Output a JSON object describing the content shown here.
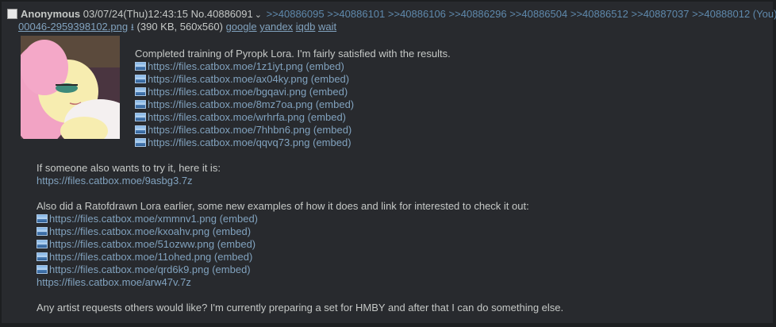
{
  "post": {
    "name": "Anonymous",
    "datetime": "03/07/24(Thu)12:43:15",
    "post_no": "No.40886091",
    "backlinks": [
      ">>40886095",
      ">>40886101",
      ">>40886106",
      ">>40886296",
      ">>40886504",
      ">>40886512",
      ">>40887037",
      ">>40888012 (You)"
    ],
    "file": {
      "name": "00046-2959398102.png",
      "meta": "(390 KB, 560x560)",
      "search_links": [
        "google",
        "yandex",
        "iqdb",
        "wait"
      ]
    },
    "intro": "Completed training of Pyropk Lora. I'm fairly satisfied with the results.",
    "links1": [
      "https://files.catbox.moe/1z1iyt.png (embed)",
      "https://files.catbox.moe/ax04ky.png (embed)",
      "https://files.catbox.moe/bgqavi.png (embed)",
      "https://files.catbox.moe/8mz7oa.png (embed)",
      "https://files.catbox.moe/wrhrfa.png (embed)",
      "https://files.catbox.moe/7hhbn6.png (embed)",
      "https://files.catbox.moe/qqvq73.png (embed)"
    ],
    "try_text": "If someone also wants to try it, here it is:",
    "try_link": "https://files.catbox.moe/9asbg3.7z",
    "also_text": "Also did a Ratofdrawn Lora earlier, some new examples of how it does and link for interested to check it out:",
    "links2": [
      "https://files.catbox.moe/xmmnv1.png (embed)",
      "https://files.catbox.moe/kxoahv.png (embed)",
      "https://files.catbox.moe/51ozww.png (embed)",
      "https://files.catbox.moe/11ohed.png (embed)",
      "https://files.catbox.moe/qrd6k9.png (embed)"
    ],
    "arw_link": "https://files.catbox.moe/arw47v.7z",
    "closing": "Any artist requests others would like? I'm currently preparing a set for HMBY and after that I can do something else."
  }
}
